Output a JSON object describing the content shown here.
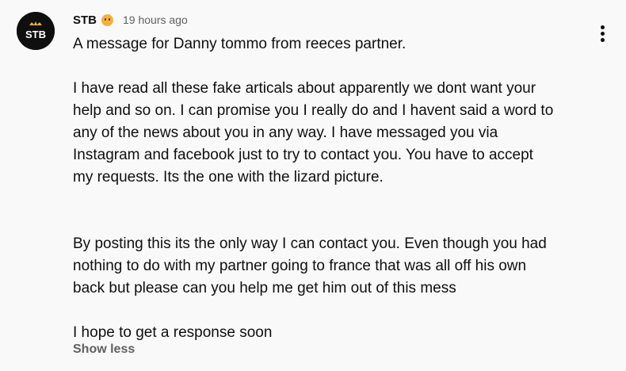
{
  "comment": {
    "author": "STB",
    "avatar_text": "STB",
    "time": "19 hours ago",
    "lines_1": [
      "A message for Danny tommo from reeces partner."
    ],
    "lines_2": [
      "I have read all these fake articals about apparently we dont want your",
      "help and so on. I can promise you I really do and I havent said a word to",
      "any of the news about you in any way. I have messaged you via",
      "Instagram and facebook just to try to contact you. You have to accept",
      "my requests. Its the one with the lizard picture."
    ],
    "lines_3": [
      "By posting this its the only way I can contact you. Even though you had",
      "nothing to do with my partner going to france that was all off his own",
      "back but please can you help me get him out of this mess"
    ],
    "lines_4": [
      "I hope to get a response soon"
    ],
    "show_less": "Show less"
  },
  "icons": {
    "author_badge": "smiley-emoji-icon",
    "menu": "more-vert-icon"
  },
  "colors": {
    "background": "#f9f9f9",
    "text": "#0f0f0f",
    "secondary": "#606060"
  }
}
